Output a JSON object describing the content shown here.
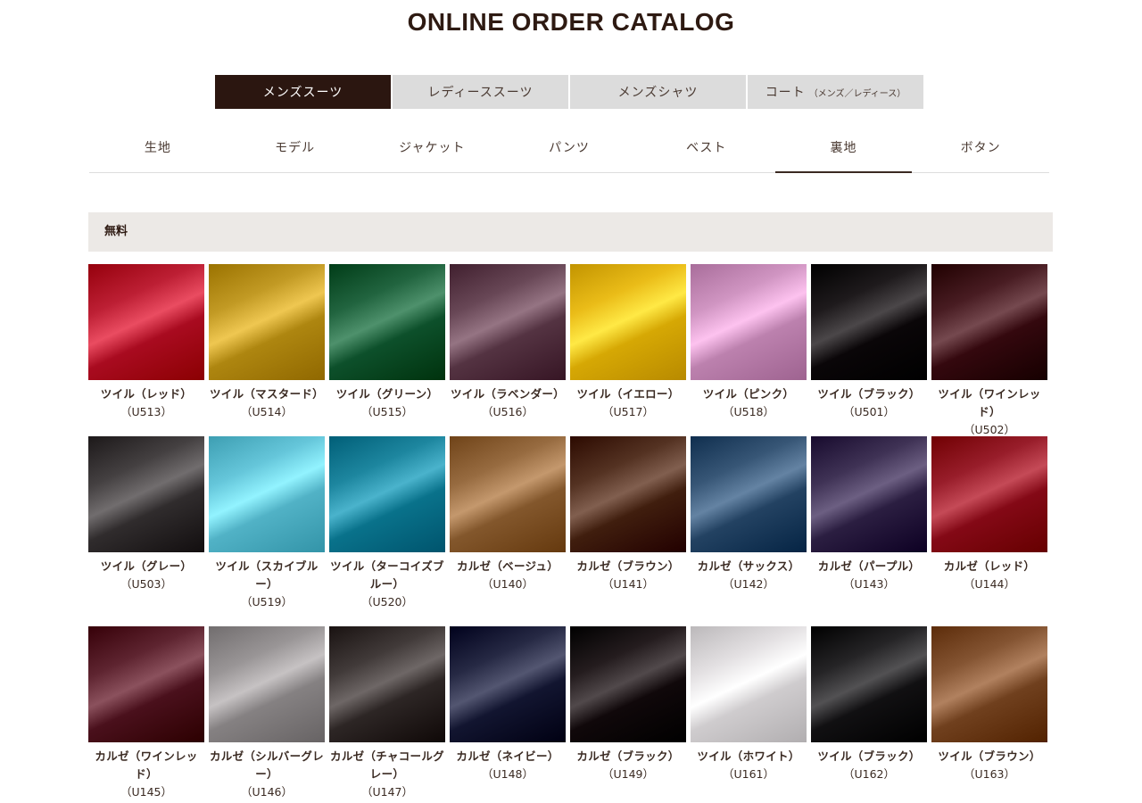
{
  "title": "ONLINE ORDER CATALOG",
  "main_tabs": [
    {
      "label": "メンズスーツ",
      "sub": ""
    },
    {
      "label": "レディーススーツ",
      "sub": ""
    },
    {
      "label": "メンズシャツ",
      "sub": ""
    },
    {
      "label": "コート",
      "sub": "（メンズ／レディース）"
    }
  ],
  "main_tab_active": 0,
  "sub_tabs": [
    "生地",
    "モデル",
    "ジャケット",
    "パンツ",
    "ベスト",
    "裏地",
    "ボタン"
  ],
  "sub_tab_active": 5,
  "section_label": "無料",
  "swatches": [
    {
      "name": "ツイル（レッド）",
      "code": "（U513）",
      "color": "#b3152a"
    },
    {
      "name": "ツイル（マスタード）",
      "code": "（U514）",
      "color": "#b8901a"
    },
    {
      "name": "ツイル（グリーン）",
      "code": "（U515）",
      "color": "#175a35"
    },
    {
      "name": "ツイル（ラベンダー）",
      "code": "（U516）",
      "color": "#5e3d4c"
    },
    {
      "name": "ツイル（イエロー）",
      "code": "（U517）",
      "color": "#e0b20e"
    },
    {
      "name": "ツイル（ピンク）",
      "code": "（U518）",
      "color": "#c68bb8"
    },
    {
      "name": "ツイル（ブラック）",
      "code": "（U501）",
      "color": "#141012"
    },
    {
      "name": "ツイル（ワインレッド）",
      "code": "（U502）",
      "color": "#3e1218"
    },
    {
      "name": "ツイル（グレー）",
      "code": "（U503）",
      "color": "#3a3637"
    },
    {
      "name": "ツイル（スカイブルー）",
      "code": "（U519）",
      "color": "#5bbcd0"
    },
    {
      "name": "ツイル（ターコイズブルー）",
      "code": "（U520）",
      "color": "#137c95"
    },
    {
      "name": "カルゼ（ベージュ）",
      "code": "（U140）",
      "color": "#8d6136"
    },
    {
      "name": "カルゼ（ブラウン）",
      "code": "（U141）",
      "color": "#4a2818"
    },
    {
      "name": "カルゼ（サックス）",
      "code": "（U142）",
      "color": "#2d4c6c"
    },
    {
      "name": "カルゼ（パープル）",
      "code": "（U143）",
      "color": "#35284b"
    },
    {
      "name": "カルゼ（レッド）",
      "code": "（U144）",
      "color": "#8e1320"
    },
    {
      "name": "カルゼ（ワインレッド）",
      "code": "（U145）",
      "color": "#541a26"
    },
    {
      "name": "カルゼ（シルバーグレー）",
      "code": "（U146）",
      "color": "#8f8b8c"
    },
    {
      "name": "カルゼ（チャコールグレー）",
      "code": "（U147）",
      "color": "#37302f"
    },
    {
      "name": "カルゼ（ネイビー）",
      "code": "（U148）",
      "color": "#1c1f3a"
    },
    {
      "name": "カルゼ（ブラック）",
      "code": "（U149）",
      "color": "#1a1214"
    },
    {
      "name": "ツイル（ホワイト）",
      "code": "（U161）",
      "color": "#d9d6d8"
    },
    {
      "name": "ツイル（ブラック）",
      "code": "（U162）",
      "color": "#1b1a1c"
    },
    {
      "name": "ツイル（ブラウン）",
      "code": "（U163）",
      "color": "#7a4a28"
    }
  ]
}
